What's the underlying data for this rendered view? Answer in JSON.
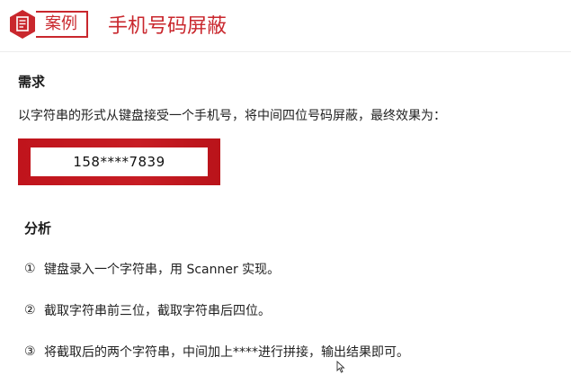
{
  "header": {
    "tag": "案例",
    "title": "手机号码屏蔽",
    "accent_color": "#c9272d",
    "icon": "document-icon"
  },
  "requirement": {
    "heading": "需求",
    "text": "以字符串的形式从键盘接受一个手机号，将中间四位号码屏蔽，最终效果为：",
    "result": "158****7839"
  },
  "analysis": {
    "heading": "分析",
    "steps": [
      {
        "num": "①",
        "text": "键盘录入一个字符串，用 Scanner 实现。"
      },
      {
        "num": "②",
        "text": "截取字符串前三位，截取字符串后四位。"
      },
      {
        "num": "③",
        "text": "将截取后的两个字符串，中间加上****进行拼接，输出结果即可。"
      }
    ]
  }
}
